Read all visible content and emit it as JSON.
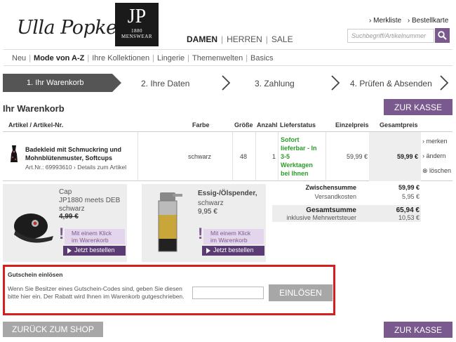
{
  "brand": {
    "logo_text": "Ulla Popken",
    "jp_logo_main": "JP",
    "jp_logo_year": "1880",
    "jp_logo_sub": "MENSWEAR"
  },
  "gender_nav": {
    "damen": "DAMEN",
    "herren": "HERREN",
    "sale": "SALE",
    "separator": "|"
  },
  "top_links": {
    "wishlist": "› Merkliste",
    "order_list": "› Bestellkarte"
  },
  "search": {
    "placeholder": "Suchbegriff/Artikelnummer"
  },
  "main_nav": [
    "Neu",
    "Mode von A-Z",
    "Ihre Kollektionen",
    "Lingerie",
    "Themenwelten",
    "Basics"
  ],
  "steps": [
    "1. Ihr Warenkorb",
    "2. Ihre Daten",
    "3. Zahlung",
    "4. Prüfen & Absenden"
  ],
  "page_title": "Ihr Warenkorb",
  "checkout_label": "ZUR KASSE",
  "table": {
    "headers": {
      "article": "Artikel / Artikel-Nr.",
      "color": "Farbe",
      "size": "Größe",
      "qty": "Anzahl",
      "delivery": "Lieferstatus",
      "unit_price": "Einzelpreis",
      "total": "Gesamtpreis"
    },
    "item": {
      "name_line1": "Badekleid mit Schmuckring und",
      "name_line2": "Mohnblütenmuster, Softcups",
      "article_no": "Art.Nr.: 69993610",
      "details_link": "› Details zum Artikel",
      "color": "schwarz",
      "size": "48",
      "qty": "1",
      "delivery_l1": "Sofort",
      "delivery_l2": "lieferbar - In",
      "delivery_l3": "3-5",
      "delivery_l4": "Werktagen",
      "delivery_l5": "bei Ihnen",
      "unit_price": "59,99 €",
      "total": "59,99 €",
      "action_remember": "› merken",
      "action_change": "› ändern",
      "action_delete": "⊗ löschen"
    }
  },
  "promos": [
    {
      "title_l1": "Cap",
      "title_l2": "JP1880 meets DEB",
      "color": "schwarz",
      "price": "4,99 €",
      "click_l1": "Mit einem Klick",
      "click_l2": "im Warenkorb",
      "order": "Jetzt bestellen"
    },
    {
      "title_l1": "Essig-/Ölspender,",
      "title_l2": "",
      "color": "schwarz",
      "price": "9,95 €",
      "click_l1": "Mit einem Klick",
      "click_l2": "im Warenkorb",
      "order": "Jetzt bestellen"
    }
  ],
  "totals": {
    "subtotal_label": "Zwischensumme",
    "subtotal_value": "59,99 €",
    "shipping_label": "Versandkosten",
    "shipping_value": "5,95 €",
    "grand_label": "Gesamtsumme",
    "grand_value": "65,94 €",
    "vat_label": "inklusive Mehrwertsteuer",
    "vat_value": "10,53 €"
  },
  "voucher": {
    "title": "Gutschein einlösen",
    "text": "Wenn Sie Besitzer eines Gutschein-Codes sind, geben Sie diesen bitte hier ein. Der Rabatt wird Ihnen im Warenkorb gutgeschrieben.",
    "button": "EINLÖSEN"
  },
  "back_button": "ZURÜCK ZUM SHOP",
  "colors": {
    "accent": "#7a5a8e",
    "highlight_border": "#d71e1e",
    "grey_button": "#a7a7a7",
    "in_stock": "#2a9d2a"
  }
}
